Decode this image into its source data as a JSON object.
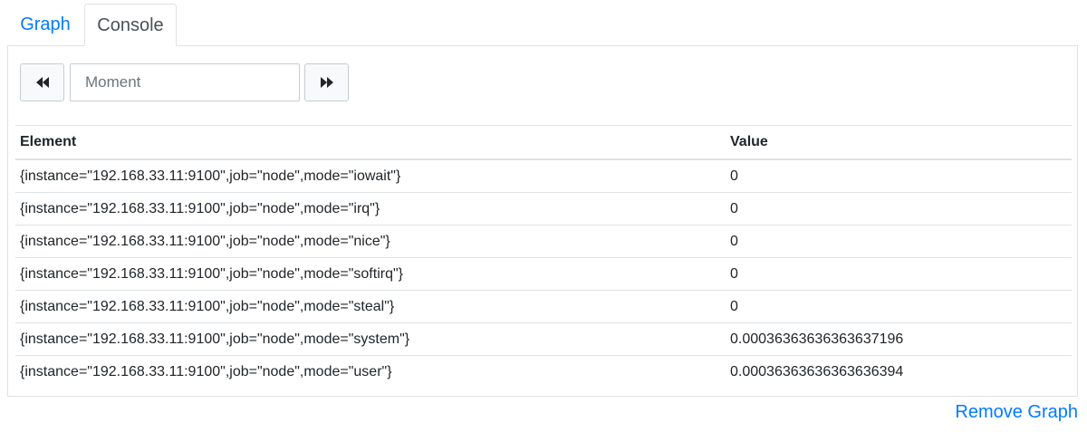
{
  "tabs": {
    "graph_label": "Graph",
    "console_label": "Console"
  },
  "console": {
    "moment_placeholder": "Moment",
    "back_icon": "fast-backward-icon",
    "forward_icon": "fast-forward-icon",
    "table": {
      "headers": [
        "Element",
        "Value"
      ],
      "rows": [
        {
          "element": "{instance=\"192.168.33.11:9100\",job=\"node\",mode=\"iowait\"}",
          "value": "0"
        },
        {
          "element": "{instance=\"192.168.33.11:9100\",job=\"node\",mode=\"irq\"}",
          "value": "0"
        },
        {
          "element": "{instance=\"192.168.33.11:9100\",job=\"node\",mode=\"nice\"}",
          "value": "0"
        },
        {
          "element": "{instance=\"192.168.33.11:9100\",job=\"node\",mode=\"softirq\"}",
          "value": "0"
        },
        {
          "element": "{instance=\"192.168.33.11:9100\",job=\"node\",mode=\"steal\"}",
          "value": "0"
        },
        {
          "element": "{instance=\"192.168.33.11:9100\",job=\"node\",mode=\"system\"}",
          "value": "0.00036363636363637196"
        },
        {
          "element": "{instance=\"192.168.33.11:9100\",job=\"node\",mode=\"user\"}",
          "value": "0.00036363636363636394"
        }
      ]
    }
  },
  "footer": {
    "remove_graph_label": "Remove Graph"
  },
  "colors": {
    "link": "#007bff",
    "border": "#dee2e6",
    "text": "#212529"
  }
}
